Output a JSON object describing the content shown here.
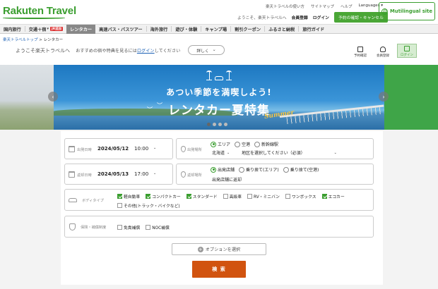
{
  "header": {
    "logo": "Rakuten Travel",
    "top_links": [
      "楽天トラベルの使い方",
      "サイトマップ",
      "ヘルプ",
      "Languages ▾"
    ],
    "welcome": "ようこそ、楽天トラベルへ",
    "member_register": "会員登録",
    "login": "ログイン",
    "confirm_cancel": "予約の確認・キャンセル",
    "multilingual": "Mutilingual site"
  },
  "nav": {
    "items": [
      "国内旅行",
      "交通＋宿",
      "レンタカー",
      "高速バス・バスツアー",
      "海外旅行",
      "遊び・体験",
      "キャンプ場",
      "割引クーポン",
      "ふるさと納税",
      "旅行ガイド"
    ],
    "badge": "JR追加",
    "arrow": "▾"
  },
  "breadcrumb": {
    "top": "楽天トラベルトップ",
    "sep": " > ",
    "current": "レンタカー"
  },
  "welcome_row": {
    "text": "ようこそ楽天トラベルへ",
    "hint_pre": "おすすめの宿や特典を見るには",
    "hint_link": "ログイン",
    "hint_post": "してください",
    "detail_btn": "詳しく",
    "detail_arrow": "⌄"
  },
  "quick": {
    "reservations": "予約確認",
    "member": "会員登録",
    "login": "ログイン"
  },
  "banner": {
    "subtitle": "あつい季節を満喫しよう!",
    "title": "レンタカー夏特集",
    "summer": "Summer",
    "prev": "‹",
    "next": "›"
  },
  "search": {
    "depart": {
      "label": "出発日時",
      "date": "2024/05/12",
      "time": "10:00",
      "chev": "⌄"
    },
    "depart_place": {
      "label": "出発場所",
      "options": [
        "エリア",
        "空港",
        "新幹線駅"
      ],
      "region": "北海道",
      "area_placeholder": "地区を選択してください（必須）",
      "chev": "⌄"
    },
    "return": {
      "label": "返却日時",
      "date": "2024/05/13",
      "time": "17:00",
      "chev": "⌄"
    },
    "return_place": {
      "label": "返却場所",
      "options": [
        "出発店舗",
        "乗り捨て(エリア)",
        "乗り捨て(空港)"
      ],
      "note": "出発店舗に返却"
    },
    "body_type": {
      "label": "ボディタイプ",
      "types": [
        {
          "name": "軽自動車",
          "checked": true
        },
        {
          "name": "コンパクトカー",
          "checked": true
        },
        {
          "name": "スタンダード",
          "checked": true
        },
        {
          "name": "高級車",
          "checked": false
        },
        {
          "name": "RV・ミニバン",
          "checked": false
        },
        {
          "name": "ワンボックス",
          "checked": false
        },
        {
          "name": "エコカー",
          "checked": true
        },
        {
          "name": "その他(トラック・バイクなど)",
          "checked": false
        }
      ]
    },
    "insurance": {
      "label": "保険・補償制度",
      "items": [
        {
          "name": "免責補償",
          "checked": false
        },
        {
          "name": "NOC補償",
          "checked": false
        }
      ]
    },
    "option_btn": "オプションを選択",
    "option_plus": "+",
    "search_btn": "検 索"
  },
  "colors": {
    "brand_green": "#3a9e2f",
    "search_orange": "#d1530f",
    "banner_blue": "#1d78c1"
  }
}
